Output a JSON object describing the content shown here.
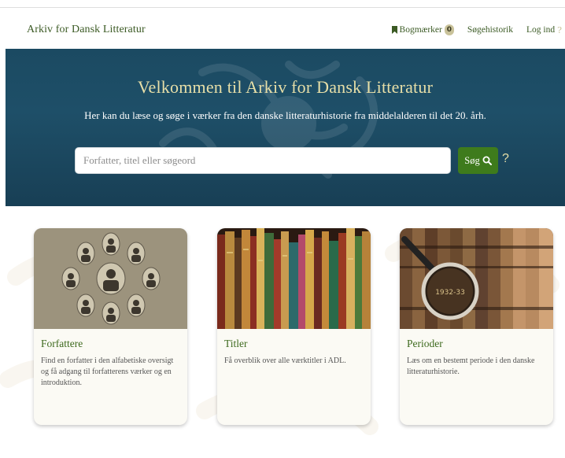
{
  "navbar": {
    "brand": "Arkiv for Dansk Litteratur",
    "bookmarks_label": "Bogmærker",
    "bookmarks_count": "0",
    "search_history_label": "Søgehistorik",
    "login_label": "Log ind",
    "help": "?"
  },
  "hero": {
    "title": "Velkommen til Arkiv for Dansk Litteratur",
    "subtitle": "Her kan du læse og søge i værker fra den danske litteraturhistorie fra middelalderen til det 20. årh.",
    "search_placeholder": "Forfatter, titel eller søgeord",
    "search_button": "Søg",
    "help": "?"
  },
  "cards": [
    {
      "title": "Forfattere",
      "description": "Find en forfatter i den alfabetiske oversigt og få adgang til forfatterens værker og en introduktion."
    },
    {
      "title": "Titler",
      "description": "Få overblik over alle værktitler i ADL."
    },
    {
      "title": "Perioder",
      "description": "Læs om en bestemt periode i den danske litteraturhistorie.",
      "image_text": "1932-33"
    }
  ],
  "colors": {
    "brand_green": "#3b5a24",
    "hero_blue": "#1e4f68",
    "hero_title": "#e7dfa8",
    "button_green": "#3e7b1c"
  }
}
